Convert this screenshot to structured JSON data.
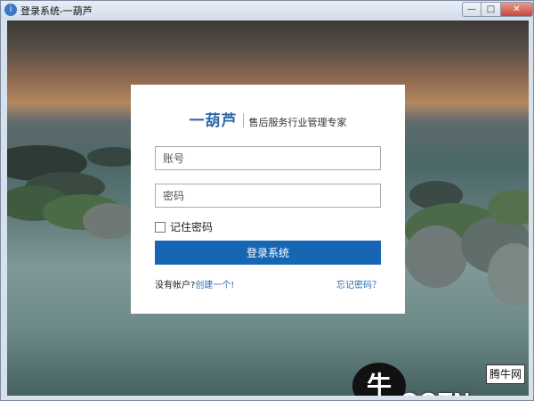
{
  "window": {
    "title": "登录系统-一葫芦",
    "app_icon": "i",
    "min_symbol": "—",
    "max_symbol": "□",
    "close_symbol": "✕"
  },
  "brand": {
    "logo": "一葫芦",
    "slogan": "售后服务行业管理专家"
  },
  "form": {
    "account_placeholder": "账号",
    "password_placeholder": "密码",
    "remember_label": "记住密码",
    "login_button": "登录系统",
    "no_account_text": "没有帐户?",
    "create_link": "创建一个!",
    "forgot_link": "忘记密码？"
  },
  "watermark": {
    "logo_char": "牛",
    "text": "QQTN.com",
    "badge": "腾牛网"
  },
  "colors": {
    "accent": "#1766b4",
    "brand": "#2f6aa8",
    "close": "#c8473b"
  }
}
